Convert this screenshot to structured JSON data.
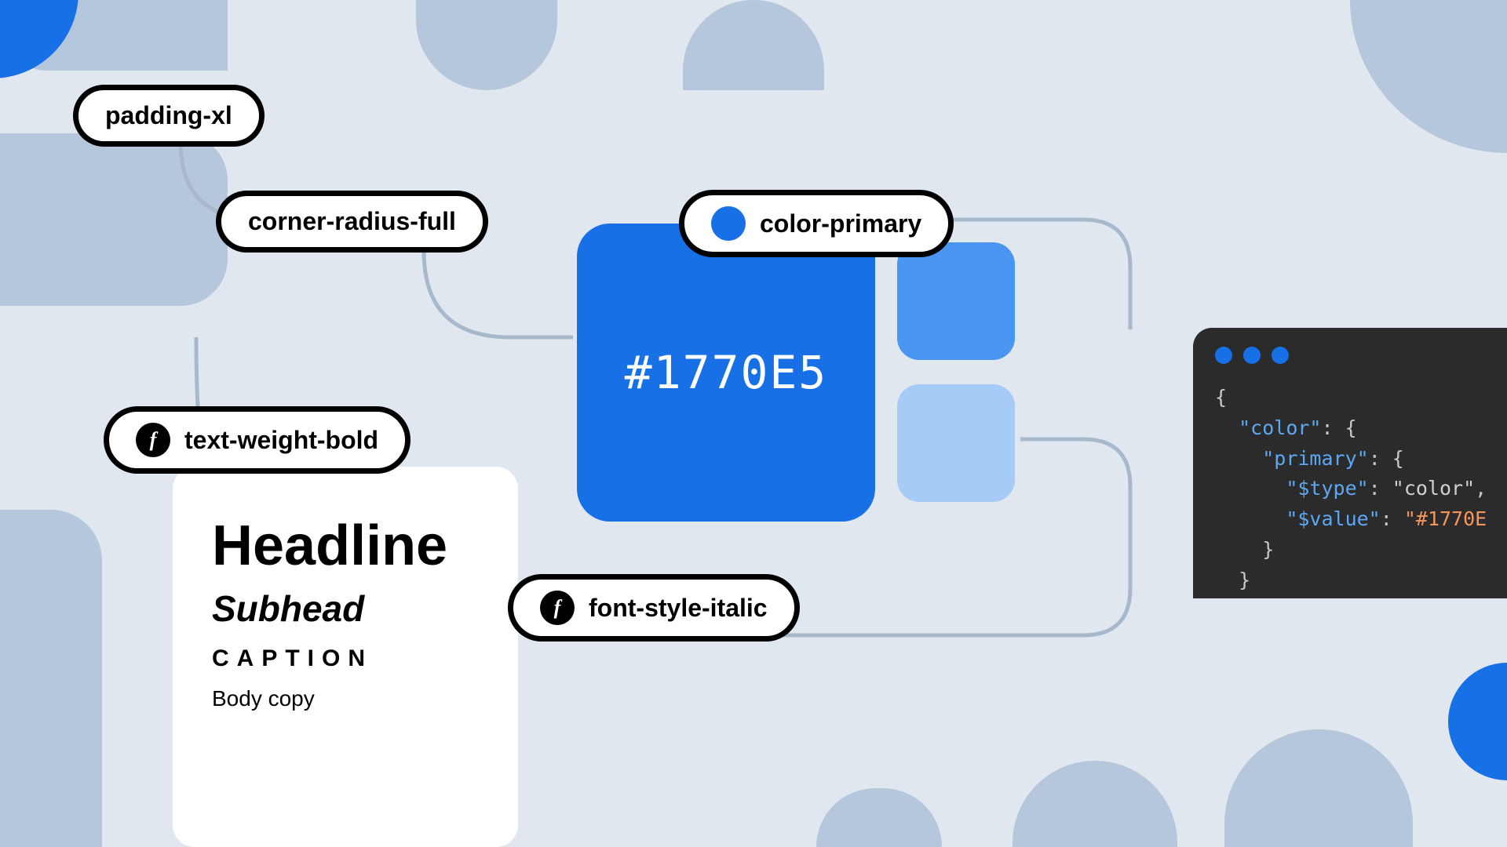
{
  "tokens": {
    "paddingXl": "padding-xl",
    "cornerRadiusFull": "corner-radius-full",
    "colorPrimary": "color-primary",
    "textWeightBold": "text-weight-bold",
    "fontStyleItalic": "font-style-italic"
  },
  "colorSwatch": {
    "hex": "#1770E5",
    "primary": "#1770E5",
    "variant1": "#4A94F2",
    "variant2": "#A7CBF7"
  },
  "typography": {
    "headline": "Headline",
    "subhead": "Subhead",
    "caption": "CAPTION",
    "body": "Body copy"
  },
  "code": {
    "brace_open": "{",
    "brace_close": "}",
    "key_color": "\"color\"",
    "key_primary": "\"primary\"",
    "key_type": "\"$type\"",
    "key_value": "\"$value\"",
    "val_color": "\"color\"",
    "val_hex": "\"#1770E",
    "colon_brace": ": {",
    "colon": ": ",
    "comma": ","
  },
  "icons": {
    "fGlyph": "f"
  }
}
